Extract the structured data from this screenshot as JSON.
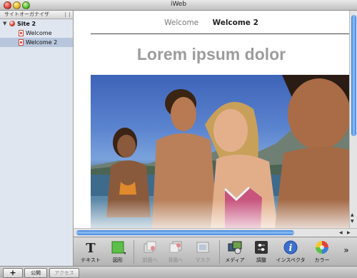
{
  "window": {
    "title": "iWeb"
  },
  "sidebar": {
    "header": "サイトオーガナイザ",
    "site": {
      "label": "Site 2"
    },
    "pages": [
      {
        "label": "Welcome",
        "selected": false
      },
      {
        "label": "Welcome 2",
        "selected": true
      }
    ]
  },
  "canvas": {
    "nav": [
      "Welcome",
      "Welcome 2"
    ],
    "headline": "Lorem ipsum dolor"
  },
  "toolbar": {
    "items": [
      {
        "label": "テキスト",
        "icon": "text-icon"
      },
      {
        "label": "図形",
        "icon": "shape-icon"
      },
      {
        "label": "前面へ",
        "icon": "bring-front-icon",
        "disabled": true
      },
      {
        "label": "背面へ",
        "icon": "send-back-icon",
        "disabled": true
      },
      {
        "label": "マスク",
        "icon": "mask-icon",
        "disabled": true
      },
      {
        "label": "メディア",
        "icon": "media-icon"
      },
      {
        "label": "調整",
        "icon": "adjust-icon"
      },
      {
        "label": "インスペクタ",
        "icon": "inspector-icon"
      },
      {
        "label": "カラー",
        "icon": "color-icon"
      }
    ],
    "more": "»"
  },
  "bottom": {
    "publish": "公開",
    "visit": "アクセス"
  },
  "colors": {
    "scroll_accent": "#3f7fd9",
    "headline": "#9c9c9c",
    "sidebar_bg": "#dfe6f0"
  }
}
